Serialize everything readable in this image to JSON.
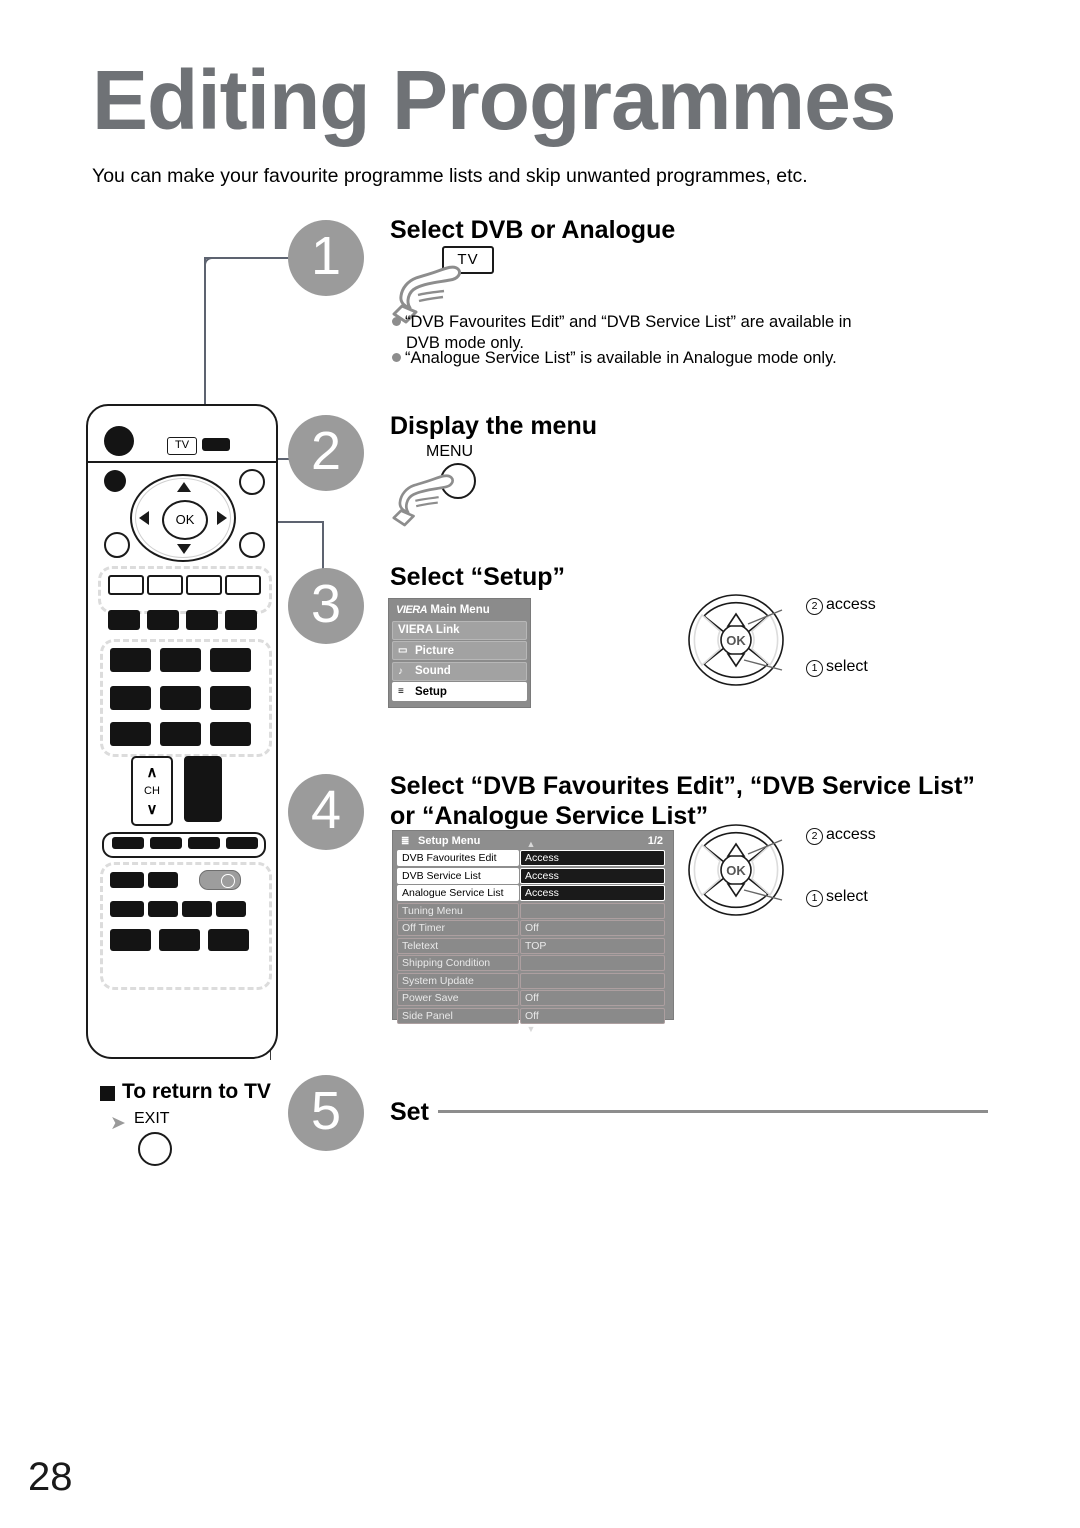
{
  "page": {
    "title": "Editing Programmes",
    "subtitle": "You can make your favourite programme lists and skip unwanted programmes, etc.",
    "number": "28",
    "accent_gray": "#9b9b9b",
    "title_color": "#6f7276",
    "connector_color": "#5d6370"
  },
  "steps": [
    {
      "num": "1",
      "heading": "Select DVB or Analogue"
    },
    {
      "num": "2",
      "heading": "Display the menu"
    },
    {
      "num": "3",
      "heading": "Select “Setup”"
    },
    {
      "num": "4",
      "heading_line1": "Select “DVB Favourites Edit”, “DVB Service List”",
      "heading_line2": "or “Analogue Service List”"
    },
    {
      "num": "5",
      "heading": "Set"
    }
  ],
  "step1": {
    "tv_button_label": "TV",
    "notes": [
      "“DVB Favourites Edit” and “DVB Service List” are available in DVB mode only.",
      "“Analogue Service List” is available in Analogue mode only."
    ],
    "note1_line1": "“DVB Favourites Edit” and “DVB Service List” are available in",
    "note1_line2": "DVB mode only.",
    "note2": "“Analogue Service List” is available in Analogue mode only."
  },
  "step2": {
    "key_label": "MENU"
  },
  "step3": {
    "main_menu": {
      "brand": "VIERA",
      "title": "Main Menu",
      "items": [
        {
          "label": "VIERA Link",
          "icon": "",
          "selected": false
        },
        {
          "label": "Picture",
          "icon": "▭",
          "selected": false
        },
        {
          "label": "Sound",
          "icon": "♪",
          "selected": false
        },
        {
          "label": "Setup",
          "icon": "≡",
          "selected": true
        }
      ]
    },
    "nav": {
      "ok_label": "OK",
      "access_num": "2",
      "access_label": "access",
      "select_num": "1",
      "select_label": "select"
    }
  },
  "step4": {
    "setup_menu": {
      "title": "Setup Menu",
      "page_indicator": "1/2",
      "rows": [
        {
          "label": "DVB Favourites Edit",
          "value": "Access",
          "highlight": true
        },
        {
          "label": "DVB Service List",
          "value": "Access",
          "highlight": true
        },
        {
          "label": "Analogue Service List",
          "value": "Access",
          "highlight": true
        },
        {
          "label": "Tuning Menu",
          "value": "",
          "highlight": false
        },
        {
          "label": "Off Timer",
          "value": "Off",
          "highlight": false
        },
        {
          "label": "Teletext",
          "value": "TOP",
          "highlight": false
        },
        {
          "label": "Shipping Condition",
          "value": "",
          "highlight": false
        },
        {
          "label": "System Update",
          "value": "",
          "highlight": false
        },
        {
          "label": "Power Save",
          "value": "Off",
          "highlight": false
        },
        {
          "label": "Side Panel",
          "value": "Off",
          "highlight": false
        }
      ]
    },
    "nav": {
      "ok_label": "OK",
      "access_num": "2",
      "access_label": "access",
      "select_num": "1",
      "select_label": "select"
    }
  },
  "return_to_tv": {
    "heading": "To return to TV",
    "key_label": "EXIT"
  },
  "remote": {
    "tv_button_label": "TV",
    "ok_label": "OK",
    "ch_label": "CH",
    "ch_up": "∧",
    "ch_down": "∨"
  }
}
